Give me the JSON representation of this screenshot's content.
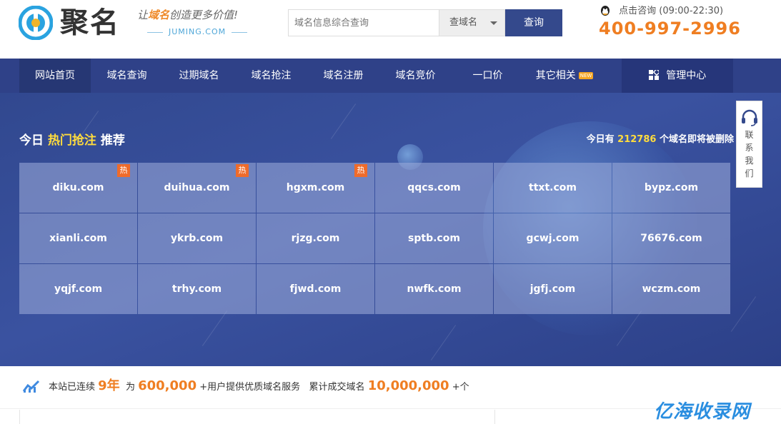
{
  "header": {
    "logo_name": "聚名",
    "slogan_pre": "让",
    "slogan_hl": "域名",
    "slogan_post": "创造更多价值!",
    "logo_domain": "JUMING.COM",
    "search_placeholder": "域名信息综合查询",
    "search_select": "查域名",
    "search_button": "查询",
    "consult_label": "点击咨询",
    "consult_hours": "(09:00-22:30)",
    "phone": "400-997-2996"
  },
  "nav": {
    "items": [
      {
        "label": "网站首页"
      },
      {
        "label": "域名查询"
      },
      {
        "label": "过期域名"
      },
      {
        "label": "域名抢注"
      },
      {
        "label": "域名注册"
      },
      {
        "label": "域名竞价"
      },
      {
        "label": "一口价"
      },
      {
        "label": "其它相关"
      }
    ],
    "new_badge": "NEW",
    "manage": "管理中心"
  },
  "banner": {
    "title_pre": "今日",
    "title_hl": "热门抢注",
    "title_post": "推荐",
    "count_pre": "今日有",
    "count_num": "212786",
    "count_post": "个域名即将被删除",
    "hot_badge": "热",
    "domains": [
      {
        "name": "diku.com",
        "hot": true
      },
      {
        "name": "duihua.com",
        "hot": true
      },
      {
        "name": "hgxm.com",
        "hot": true
      },
      {
        "name": "qqcs.com",
        "hot": false
      },
      {
        "name": "ttxt.com",
        "hot": false
      },
      {
        "name": "bypz.com",
        "hot": false
      },
      {
        "name": "xianli.com",
        "hot": false
      },
      {
        "name": "ykrb.com",
        "hot": false
      },
      {
        "name": "rjzg.com",
        "hot": false
      },
      {
        "name": "sptb.com",
        "hot": false
      },
      {
        "name": "gcwj.com",
        "hot": false
      },
      {
        "name": "76676.com",
        "hot": false
      },
      {
        "name": "yqjf.com",
        "hot": false
      },
      {
        "name": "trhy.com",
        "hot": false
      },
      {
        "name": "fjwd.com",
        "hot": false
      },
      {
        "name": "nwfk.com",
        "hot": false
      },
      {
        "name": "jgfj.com",
        "hot": false
      },
      {
        "name": "wczm.com",
        "hot": false
      }
    ]
  },
  "contact": {
    "label": "联系我们"
  },
  "stats": {
    "t1": "本站已连续",
    "years": "9年",
    "t2": "为",
    "users": "600,000",
    "t3": "+用户提供优质域名服务",
    "t4": "累计成交域名",
    "deals": "10,000,000",
    "t5": "+个"
  },
  "watermark": "亿海收录网",
  "colors": {
    "nav": "#2f4188",
    "accent": "#ef7e22",
    "highlight": "#ffdc3d",
    "button": "#34498c"
  }
}
